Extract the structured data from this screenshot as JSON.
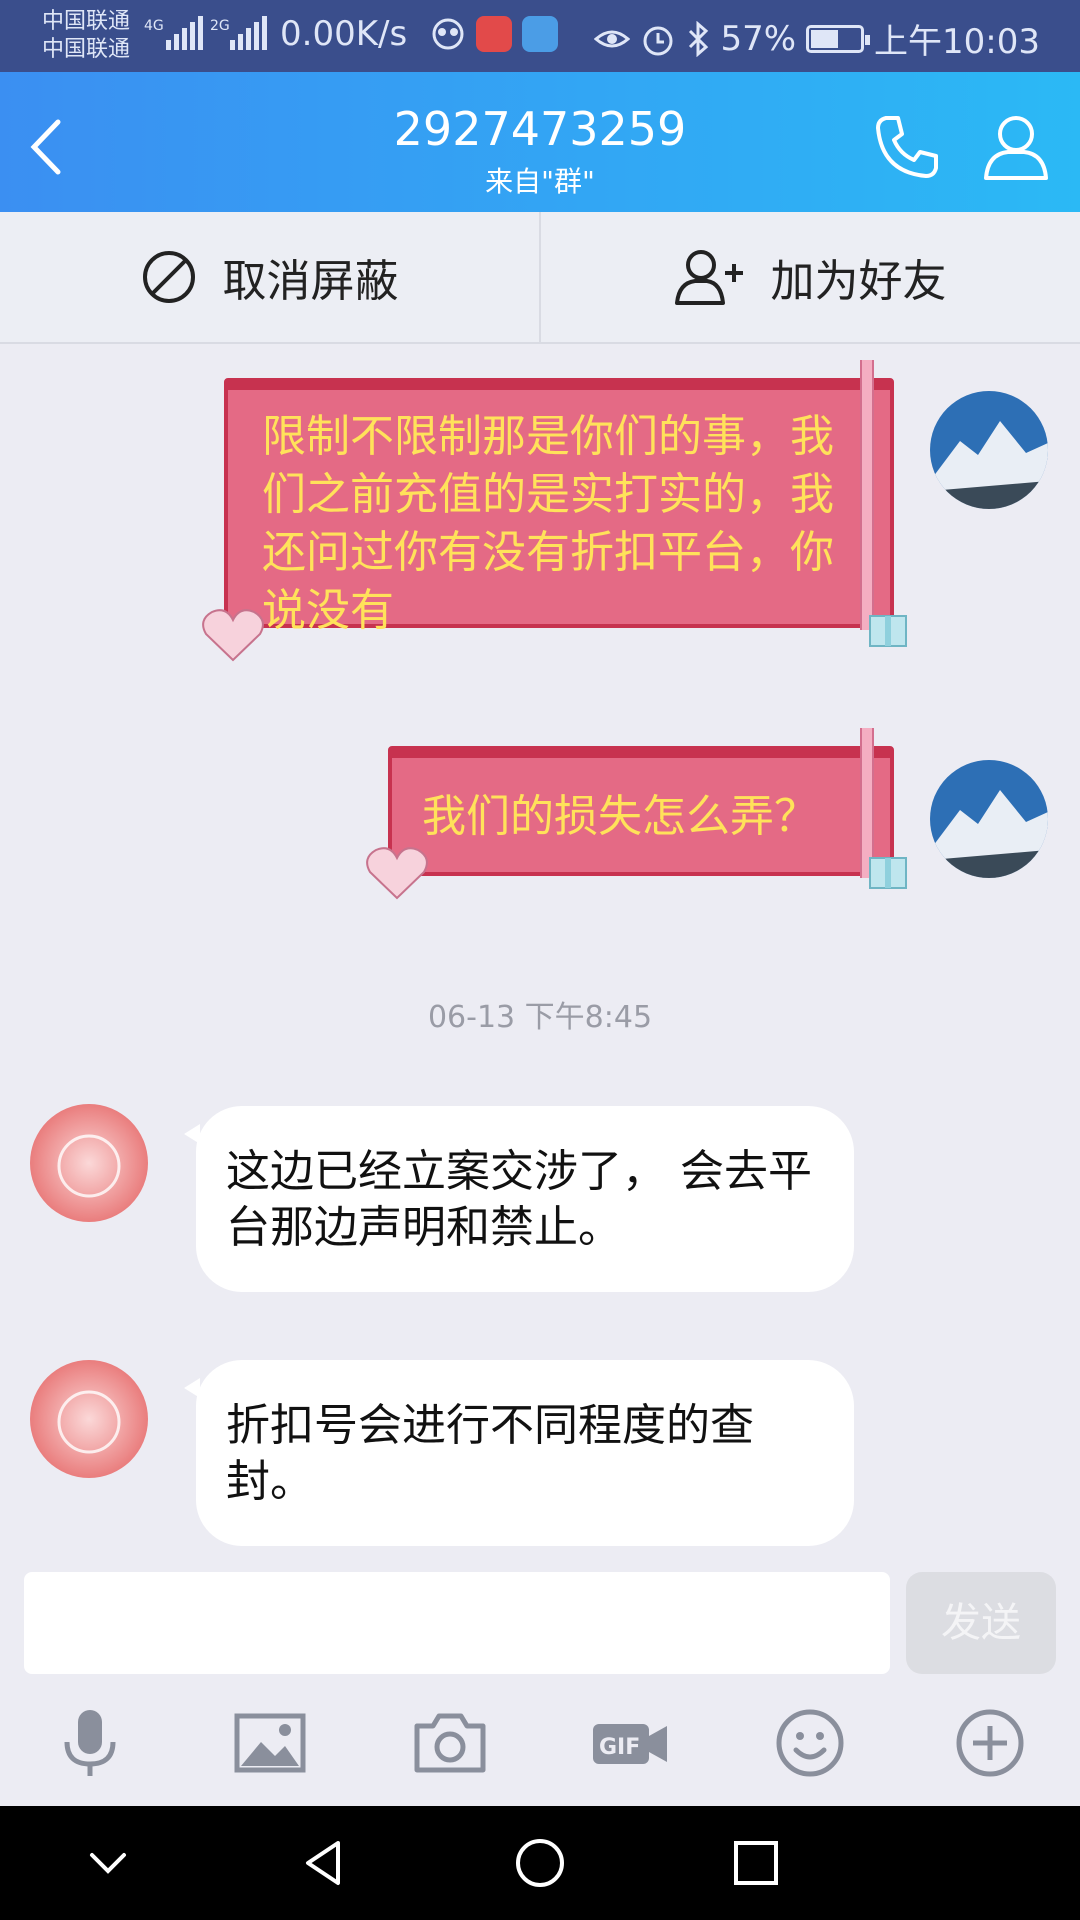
{
  "status_bar": {
    "carrier_1": "中国联通",
    "carrier_2": "中国联通",
    "net_1": "4G",
    "net_2": "2G",
    "speed": "0.00K/s",
    "battery": "57%",
    "battery_level": 0.57,
    "time": "上午10:03"
  },
  "header": {
    "title": "2927473259",
    "subtitle": "来自\"群\""
  },
  "actions": {
    "unblock_label": "取消屏蔽",
    "add_friend_label": "加为好友"
  },
  "messages": [
    {
      "side": "right",
      "style": "gift",
      "text": "限制不限制那是你们的事，我们之前充值的是实打实的，我还问过你有没有折扣平台，你说没有"
    },
    {
      "side": "right",
      "style": "gift",
      "text": "我们的损失怎么弄？"
    },
    {
      "side": "left",
      "style": "bubble",
      "text": "这边已经立案交涉了， 会去平台那边声明和禁止。"
    },
    {
      "side": "left",
      "style": "bubble",
      "text": "折扣号会进行不同程度的查封。"
    }
  ],
  "timestamp": "06-13 下午8:45",
  "input": {
    "value": "",
    "send_label": "发送"
  },
  "toolbar": [
    "mic-icon",
    "image-icon",
    "camera-icon",
    "gif-icon",
    "emoji-icon",
    "plus-icon"
  ],
  "colors": {
    "header_start": "#3b8ff2",
    "header_end": "#2bb9f5",
    "gift_fill": "#e46a85",
    "gift_text": "#ffe25a"
  }
}
